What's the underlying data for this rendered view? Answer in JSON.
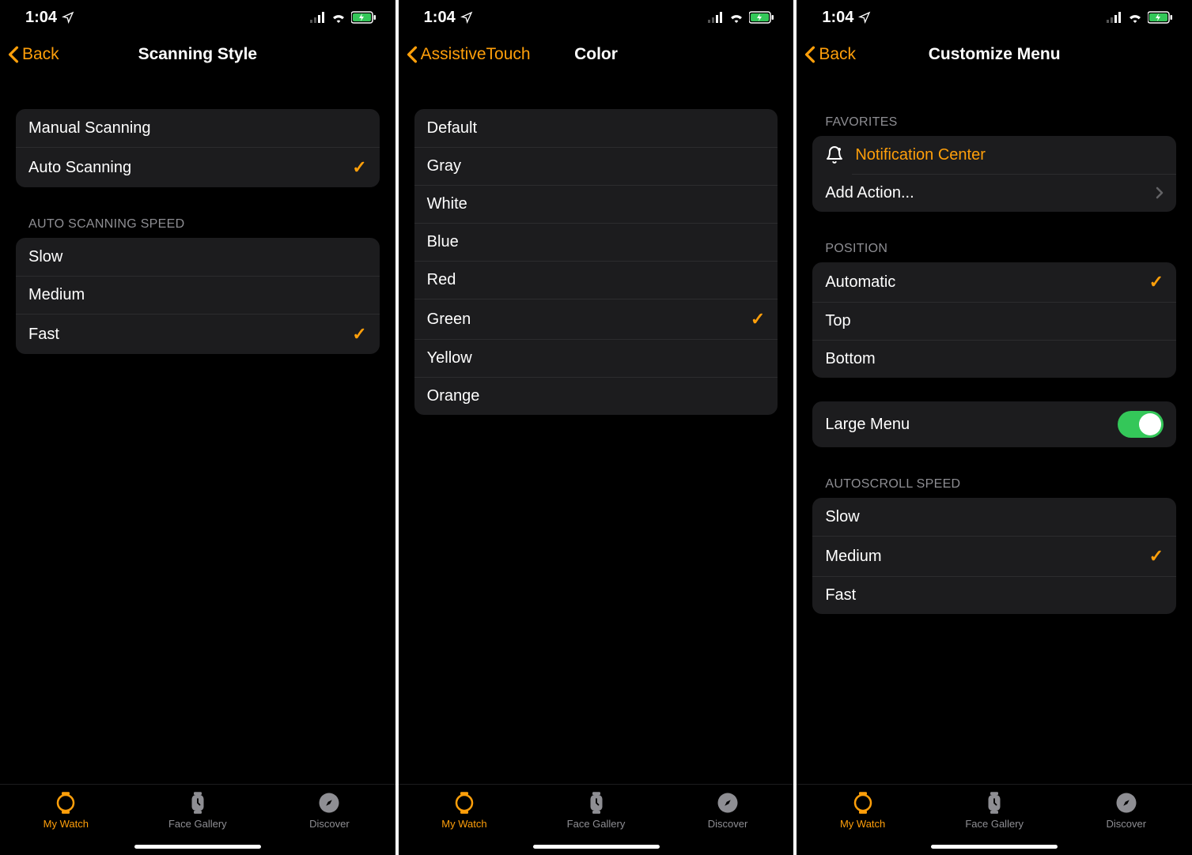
{
  "status": {
    "time": "1:04"
  },
  "tabs": {
    "mywatch": "My Watch",
    "facegallery": "Face Gallery",
    "discover": "Discover"
  },
  "screen1": {
    "back": "Back",
    "title": "Scanning Style",
    "group1": [
      {
        "label": "Manual Scanning",
        "checked": false
      },
      {
        "label": "Auto Scanning",
        "checked": true
      }
    ],
    "section2_header": "Auto Scanning Speed",
    "group2": [
      {
        "label": "Slow",
        "checked": false
      },
      {
        "label": "Medium",
        "checked": false
      },
      {
        "label": "Fast",
        "checked": true
      }
    ]
  },
  "screen2": {
    "back": "AssistiveTouch",
    "title": "Color",
    "group1": [
      {
        "label": "Default",
        "checked": false
      },
      {
        "label": "Gray",
        "checked": false
      },
      {
        "label": "White",
        "checked": false
      },
      {
        "label": "Blue",
        "checked": false
      },
      {
        "label": "Red",
        "checked": false
      },
      {
        "label": "Green",
        "checked": true
      },
      {
        "label": "Yellow",
        "checked": false
      },
      {
        "label": "Orange",
        "checked": false
      }
    ]
  },
  "screen3": {
    "back": "Back",
    "title": "Customize Menu",
    "favorites_header": "Favorites",
    "favorites": {
      "notification": "Notification Center",
      "add_action": "Add Action..."
    },
    "position_header": "Position",
    "position": [
      {
        "label": "Automatic",
        "checked": true
      },
      {
        "label": "Top",
        "checked": false
      },
      {
        "label": "Bottom",
        "checked": false
      }
    ],
    "large_menu_label": "Large Menu",
    "large_menu_on": true,
    "autoscroll_header": "Autoscroll Speed",
    "autoscroll": [
      {
        "label": "Slow",
        "checked": false
      },
      {
        "label": "Medium",
        "checked": true
      },
      {
        "label": "Fast",
        "checked": false
      }
    ]
  }
}
